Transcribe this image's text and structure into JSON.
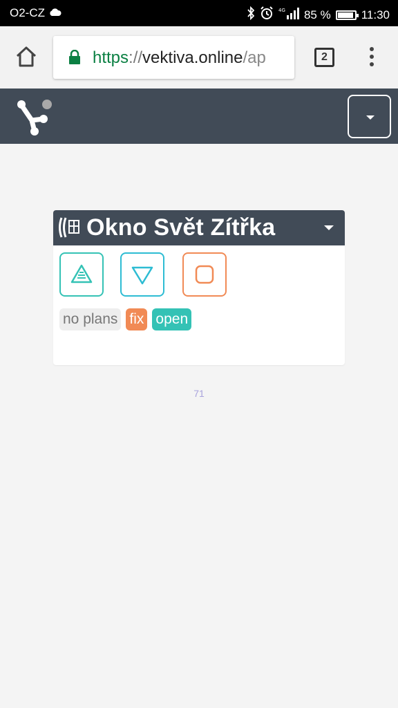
{
  "statusbar": {
    "carrier": "O2-CZ",
    "network": "4G",
    "battery_percent": "85 %",
    "battery_level": 0.85,
    "time": "11:30"
  },
  "browser": {
    "url_scheme": "https",
    "url_sep": "://",
    "url_host": "vektiva.online",
    "url_path": "/ap",
    "tab_count": "2"
  },
  "card": {
    "title": "Okno Svět Zítřka",
    "controls": {
      "up": "triangle-up-lines-icon",
      "down": "triangle-down-icon",
      "stop": "rounded-square-stop-icon"
    },
    "badges": {
      "plans": "no plans",
      "fix": "fix",
      "open": "open"
    }
  },
  "footer": {
    "number": "71"
  },
  "colors": {
    "header": "#414b57",
    "teal": "#34c2b5",
    "cyan": "#2dbcd3",
    "orange": "#f18a55",
    "url_green": "#0b8043",
    "footer_num": "#a9a3dd"
  }
}
